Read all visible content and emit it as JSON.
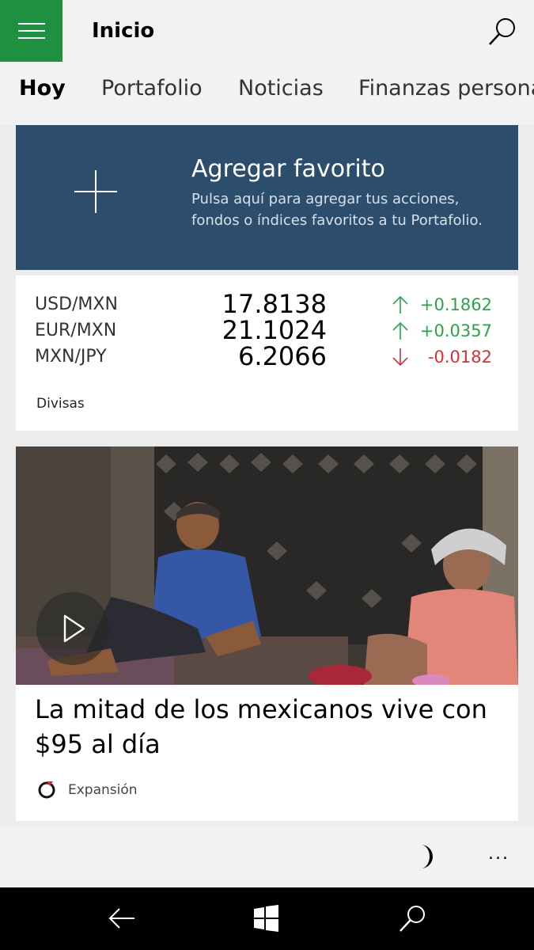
{
  "header": {
    "title": "Inicio",
    "menu_icon": "hamburger-menu-icon",
    "search_icon": "search-icon",
    "accent": "#1e9140"
  },
  "tabs": [
    {
      "label": "Hoy",
      "active": true
    },
    {
      "label": "Portafolio",
      "active": false
    },
    {
      "label": "Noticias",
      "active": false
    },
    {
      "label": "Finanzas personales",
      "active": false
    }
  ],
  "favorite": {
    "title": "Agregar favorito",
    "description": "Pulsa aquí para agregar tus acciones, fondos o índices favoritos a tu Portafolio.",
    "icon": "plus-icon",
    "background": "#2c4e6c"
  },
  "currencies": {
    "label": "Divisas",
    "rows": [
      {
        "pair": "USD/MXN",
        "value": "17.8138",
        "direction": "up",
        "change": "+0.1862"
      },
      {
        "pair": "EUR/MXN",
        "value": "21.1024",
        "direction": "up",
        "change": "+0.0357"
      },
      {
        "pair": "MXN/JPY",
        "value": "6.2066",
        "direction": "down",
        "change": "-0.0182"
      }
    ],
    "up_color": "#2aa449",
    "down_color": "#d4313b"
  },
  "news": {
    "headline": "La mitad de los mexicanos vive con $95 al día",
    "source": "Expansión",
    "media_icon": "play-icon",
    "source_icon": "expansion-logo-icon"
  },
  "appbar": {
    "theme_icon": "moon-icon",
    "more_label": "..."
  },
  "navbar": {
    "icons": [
      "back-icon",
      "windows-start-icon",
      "search-icon"
    ]
  }
}
